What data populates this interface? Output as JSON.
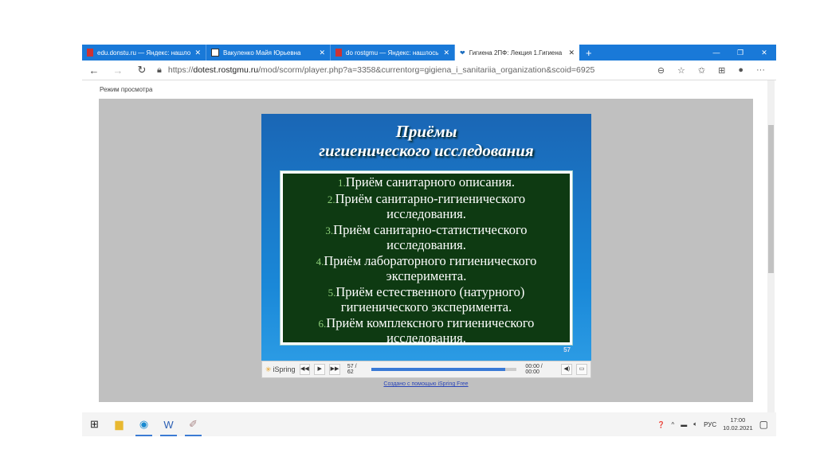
{
  "browser": {
    "tabs": [
      {
        "title": "edu.donstu.ru — Яндекс: нашлось",
        "active": false
      },
      {
        "title": "Вакуленко Майя Юрьевна",
        "active": false
      },
      {
        "title": "do rostgmu — Яндекс: нашлось",
        "active": false
      },
      {
        "title": "Гигиена 2ПФ: Лекция 1.Гигиена",
        "active": true
      }
    ],
    "url_prefix": "https://",
    "url_domain": "dotest.rostgmu.ru",
    "url_path": "/mod/scorm/player.php?a=3358&currentorg=gigiena_i_sanitariia_organization&scoid=6925"
  },
  "page": {
    "mode_label": "Режим просмотра",
    "credit_link": "Создано с помощью iSpring Free"
  },
  "slide": {
    "title_line1": "Приёмы",
    "title_line2": "гигиенического исследования",
    "items": [
      {
        "num": "1.",
        "text": "Приём санитарного описания."
      },
      {
        "num": "2.",
        "text": "Приём санитарно-гигиенического исследования."
      },
      {
        "num": "3.",
        "text": "Приём санитарно-статистического исследования."
      },
      {
        "num": "4.",
        "text": "Приём лабораторного гигиенического эксперимента."
      },
      {
        "num": "5.",
        "text": "Приём естественного (натурного) гигиенического эксперимента."
      },
      {
        "num": "6.",
        "text": "Приём комплексного гигиенического исследования."
      }
    ],
    "page_number": "57"
  },
  "player": {
    "brand": "iSpring",
    "slide_counter": "57 / 62",
    "progress_percent": 92,
    "time": "00:00 / 00:00"
  },
  "taskbar": {
    "language": "РУС",
    "time": "17:00",
    "date": "10.02.2021"
  }
}
